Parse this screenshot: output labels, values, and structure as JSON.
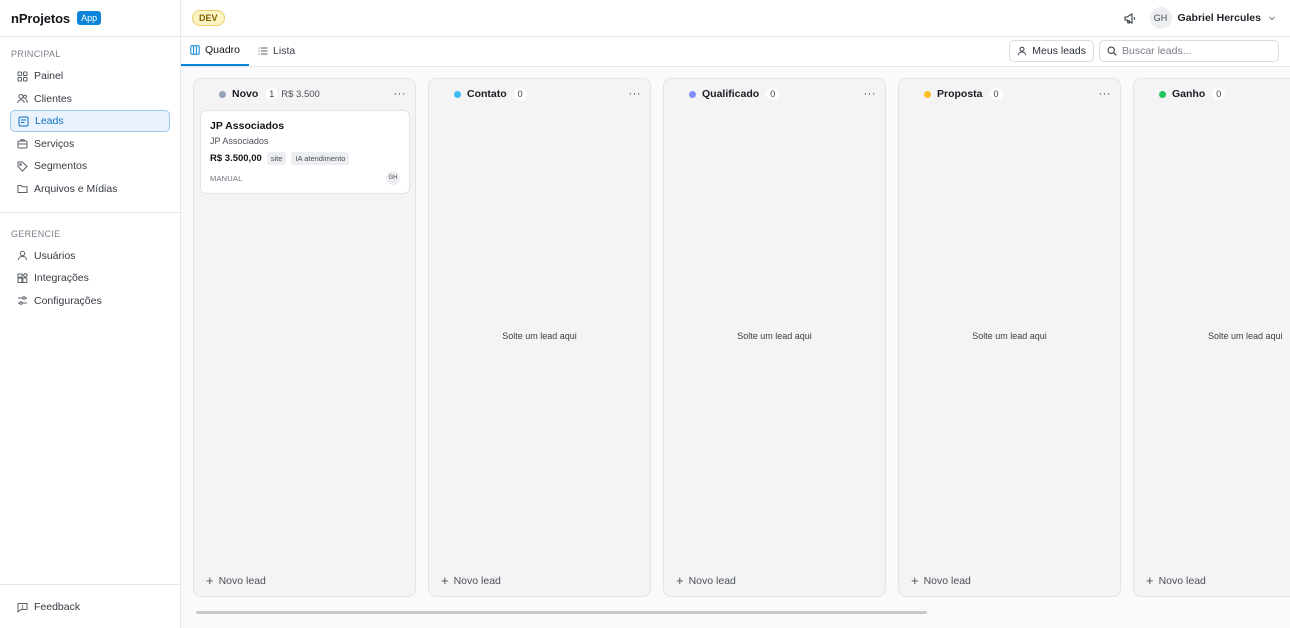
{
  "brand": {
    "name": "nProjetos",
    "badge": "App"
  },
  "sidebar": {
    "principal_title": "PRINCIPAL",
    "principal_items": [
      {
        "label": "Painel",
        "icon": "grid-icon"
      },
      {
        "label": "Clientes",
        "icon": "users-icon"
      },
      {
        "label": "Leads",
        "icon": "leads-icon",
        "active": true
      },
      {
        "label": "Serviços",
        "icon": "briefcase-icon"
      },
      {
        "label": "Segmentos",
        "icon": "tag-icon"
      },
      {
        "label": "Arquivos e Mídias",
        "icon": "folder-icon"
      }
    ],
    "gerencie_title": "GERENCIE",
    "gerencie_items": [
      {
        "label": "Usuários",
        "icon": "user-icon"
      },
      {
        "label": "Integrações",
        "icon": "puzzle-icon"
      },
      {
        "label": "Configurações",
        "icon": "settings-icon"
      }
    ],
    "feedback_label": "Feedback"
  },
  "topbar": {
    "env_badge": "DEV",
    "user_initials": "GH",
    "user_name": "Gabriel Hercules"
  },
  "views": {
    "tabs": [
      {
        "label": "Quadro",
        "active": true
      },
      {
        "label": "Lista"
      }
    ],
    "my_leads_label": "Meus leads",
    "search_placeholder": "Buscar leads..."
  },
  "board": {
    "empty_text": "Solte um lead aqui",
    "new_lead_label": "Novo lead",
    "columns": [
      {
        "title": "Novo",
        "count": "1",
        "total": "R$ 3.500",
        "color": "#94a3b8"
      },
      {
        "title": "Contato",
        "count": "0",
        "color": "#38bdf8"
      },
      {
        "title": "Qualificado",
        "count": "0",
        "color": "#818cf8"
      },
      {
        "title": "Proposta",
        "count": "0",
        "color": "#fbbf24"
      },
      {
        "title": "Ganho",
        "count": "0",
        "color": "#22c55e"
      }
    ],
    "card": {
      "title": "JP Associados",
      "company": "JP Associados",
      "value": "R$ 3.500,00",
      "tags": [
        "site",
        "IA atendimento"
      ],
      "source": "MANUAL",
      "owner_initials": "GH"
    }
  },
  "colors": {
    "accent": "#0b84d9",
    "active_bg": "#eaf3fd"
  }
}
